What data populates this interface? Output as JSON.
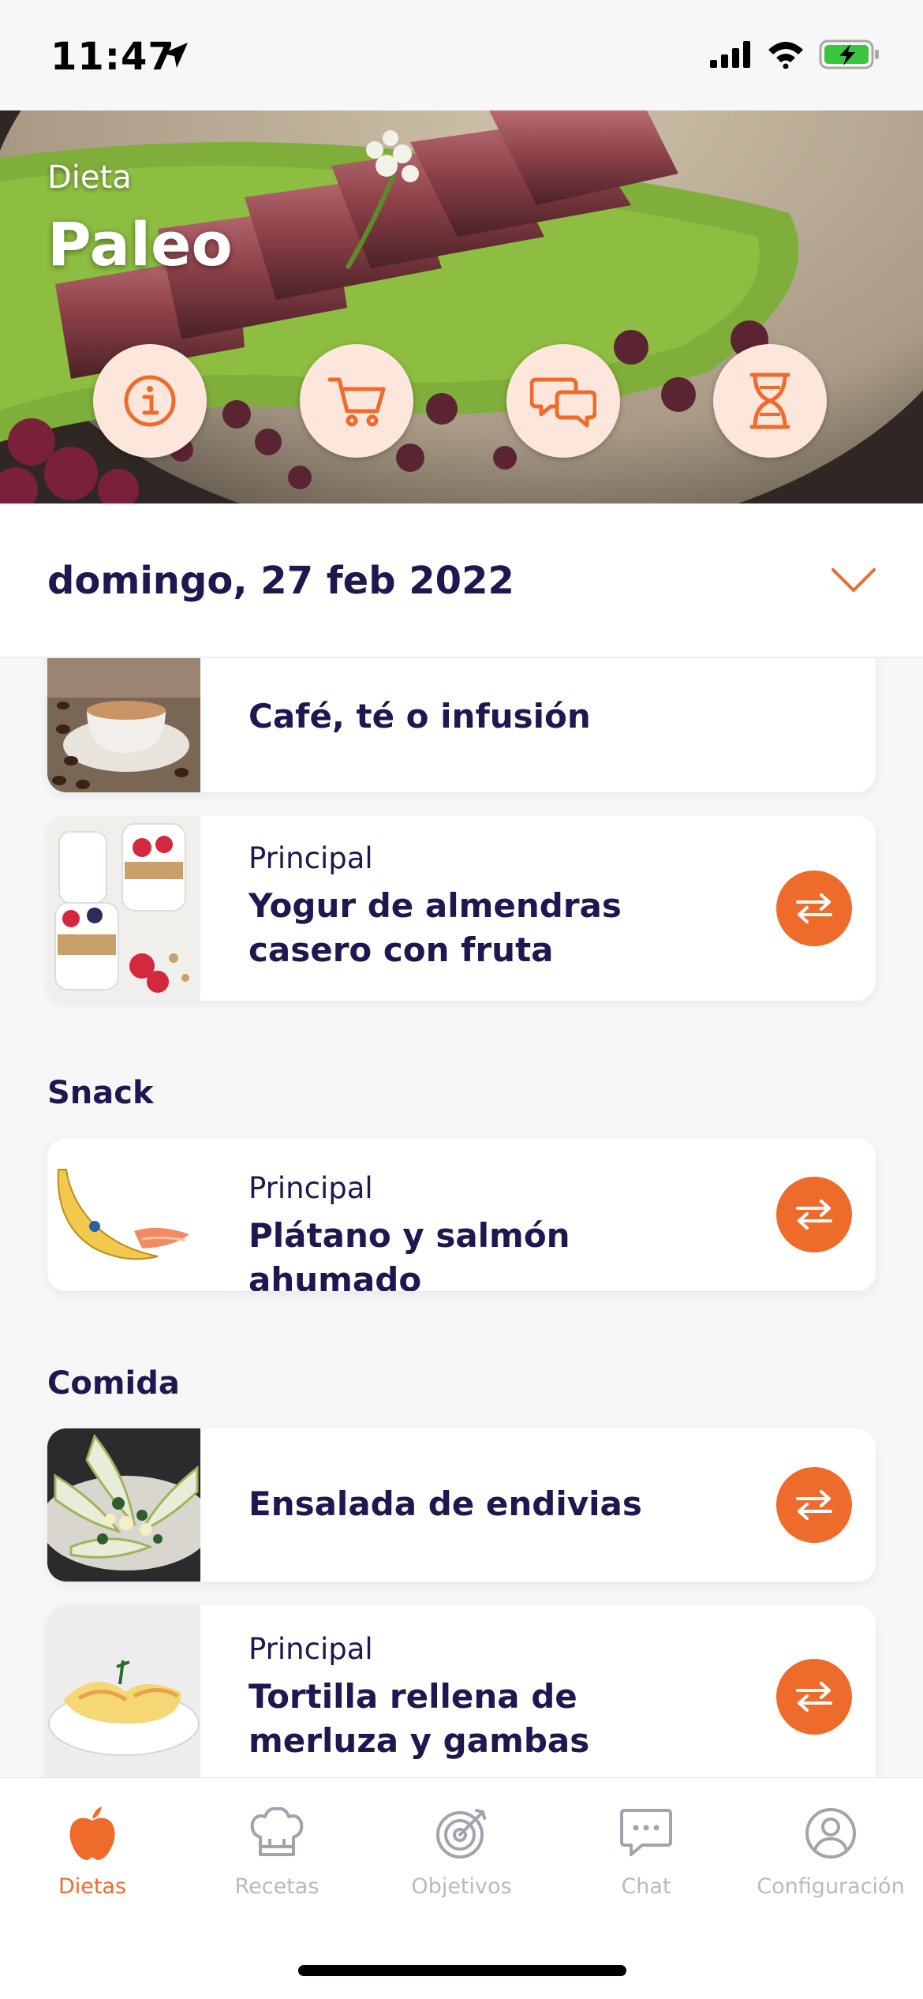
{
  "status": {
    "time": "11:47"
  },
  "hero": {
    "subtitle": "Dieta",
    "title": "Paleo",
    "actions": [
      {
        "icon": "info-icon"
      },
      {
        "icon": "cart-icon"
      },
      {
        "icon": "chat-bubbles-icon"
      },
      {
        "icon": "hourglass-icon"
      }
    ]
  },
  "date": {
    "label": "domingo, 27 feb 2022"
  },
  "meals": {
    "first": {
      "name": "Café, té o infusión"
    },
    "second": {
      "type": "Principal",
      "name": "Yogur de almendras casero con fruta"
    },
    "snack_title": "Snack",
    "snack": {
      "type": "Principal",
      "name": "Plátano y salmón ahumado"
    },
    "lunch_title": "Comida",
    "lunch1": {
      "name": "Ensalada de endivias"
    },
    "lunch2": {
      "type": "Principal",
      "name": "Tortilla rellena de merluza y gambas"
    }
  },
  "tabs": [
    {
      "label": "Dietas",
      "icon": "apple-icon",
      "active": true
    },
    {
      "label": "Recetas",
      "icon": "chef-hat-icon",
      "active": false
    },
    {
      "label": "Objetivos",
      "icon": "target-icon",
      "active": false
    },
    {
      "label": "Chat",
      "icon": "chat-icon",
      "active": false
    },
    {
      "label": "Configuración",
      "icon": "user-circle-icon",
      "active": false
    }
  ],
  "colors": {
    "accent": "#ef6b2b",
    "text": "#21164f",
    "hero_button": "#fde7dc",
    "inactive": "#b9b9c0"
  }
}
